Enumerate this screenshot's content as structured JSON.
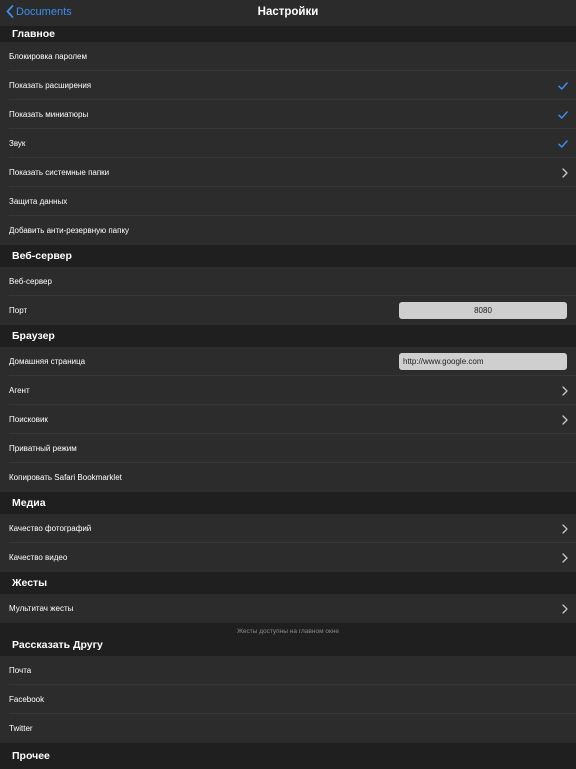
{
  "navbar": {
    "back_label": "Documents",
    "title": "Настройки"
  },
  "colors": {
    "accent": "#3a8ef0",
    "row_bg": "#2c2c2c",
    "page_bg": "#1f1f1f"
  },
  "sections": {
    "main": {
      "header": "Главное",
      "items": [
        {
          "label": "Блокировка паролем"
        },
        {
          "label": "Показать расширения",
          "accessory": "checkmark-icon"
        },
        {
          "label": "Показать миниатюры",
          "accessory": "checkmark-icon"
        },
        {
          "label": "Звук",
          "accessory": "checkmark-icon"
        },
        {
          "label": "Показать системные папки",
          "accessory": "chevron-right-icon"
        },
        {
          "label": "Защита данных"
        },
        {
          "label": "Добавить анти-резервную папку"
        }
      ]
    },
    "webserver": {
      "header": "Веб-сервер",
      "items": [
        {
          "label": "Веб-сервер"
        },
        {
          "label": "Порт",
          "value": "8080"
        }
      ]
    },
    "browser": {
      "header": "Браузер",
      "items": [
        {
          "label": "Домашняя страница",
          "value": "http://www.google.com"
        },
        {
          "label": "Агент",
          "accessory": "chevron-right-icon"
        },
        {
          "label": "Поисковик",
          "accessory": "chevron-right-icon"
        },
        {
          "label": "Приватный режим"
        },
        {
          "label": "Копировать Safari Bookmarklet"
        }
      ]
    },
    "media": {
      "header": "Медиа",
      "items": [
        {
          "label": "Качество фотографий",
          "accessory": "chevron-right-icon"
        },
        {
          "label": "Качество видео",
          "accessory": "chevron-right-icon"
        }
      ]
    },
    "gestures": {
      "header": "Жесты",
      "items": [
        {
          "label": "Мультитач жесты",
          "accessory": "chevron-right-icon"
        }
      ],
      "footer": "Жесты доступны на главном окне"
    },
    "share": {
      "header": "Рассказать Другу",
      "items": [
        {
          "label": "Почта"
        },
        {
          "label": "Facebook"
        },
        {
          "label": "Twitter"
        }
      ]
    },
    "other": {
      "header": "Прочее"
    }
  }
}
